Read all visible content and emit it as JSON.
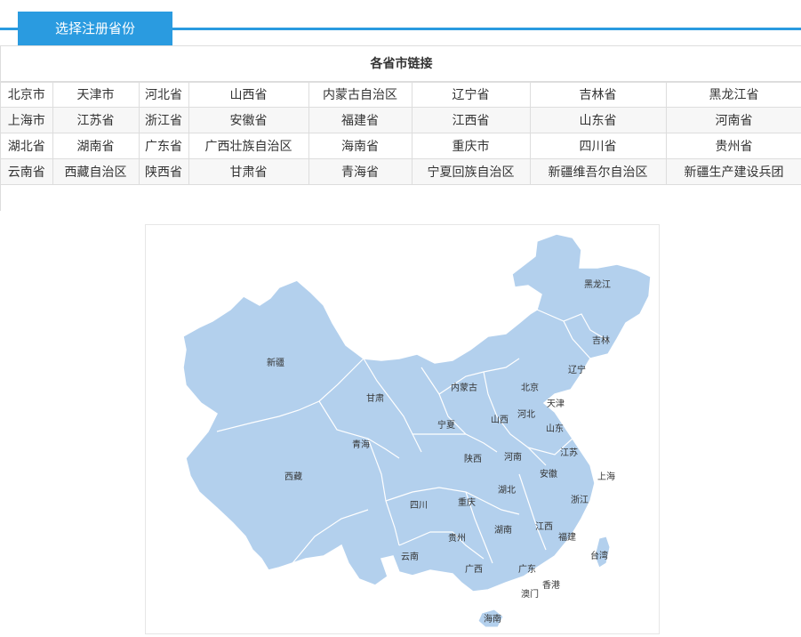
{
  "tab": {
    "label": "选择注册省份"
  },
  "table": {
    "title": "各省市链接",
    "rows": [
      [
        "北京市",
        "天津市",
        "河北省",
        "山西省",
        "内蒙古自治区",
        "辽宁省",
        "吉林省",
        "黑龙江省"
      ],
      [
        "上海市",
        "江苏省",
        "浙江省",
        "安徽省",
        "福建省",
        "江西省",
        "山东省",
        "河南省"
      ],
      [
        "湖北省",
        "湖南省",
        "广东省",
        "广西壮族自治区",
        "海南省",
        "重庆市",
        "四川省",
        "贵州省"
      ],
      [
        "云南省",
        "西藏自治区",
        "陕西省",
        "甘肃省",
        "青海省",
        "宁夏回族自治区",
        "新疆维吾尔自治区",
        "新疆生产建设兵团"
      ]
    ]
  },
  "map": {
    "fill_color": "#b3d0ed",
    "labels": {
      "heilongjiang": "黑龙江",
      "jilin": "吉林",
      "liaoning": "辽宁",
      "xinjiang": "新疆",
      "gansu": "甘肃",
      "neimenggu": "内蒙古",
      "beijing": "北京",
      "tianjin": "天津",
      "hebei": "河北",
      "shanxi": "山西",
      "ningxia": "宁夏",
      "shandong": "山东",
      "qinghai": "青海",
      "shaanxi": "陕西",
      "henan": "河南",
      "jiangsu": "江苏",
      "shanghai": "上海",
      "anhui": "安徽",
      "xizang": "西藏",
      "hubei": "湖北",
      "sichuan": "四川",
      "chongqing": "重庆",
      "zhejiang": "浙江",
      "jiangxi": "江西",
      "hunan": "湖南",
      "guizhou": "贵州",
      "fujian": "福建",
      "taiwan": "台湾",
      "yunnan": "云南",
      "guangxi": "广西",
      "guangdong": "广东",
      "xianggang": "香港",
      "aomen": "澳门",
      "hainan": "海南"
    }
  }
}
